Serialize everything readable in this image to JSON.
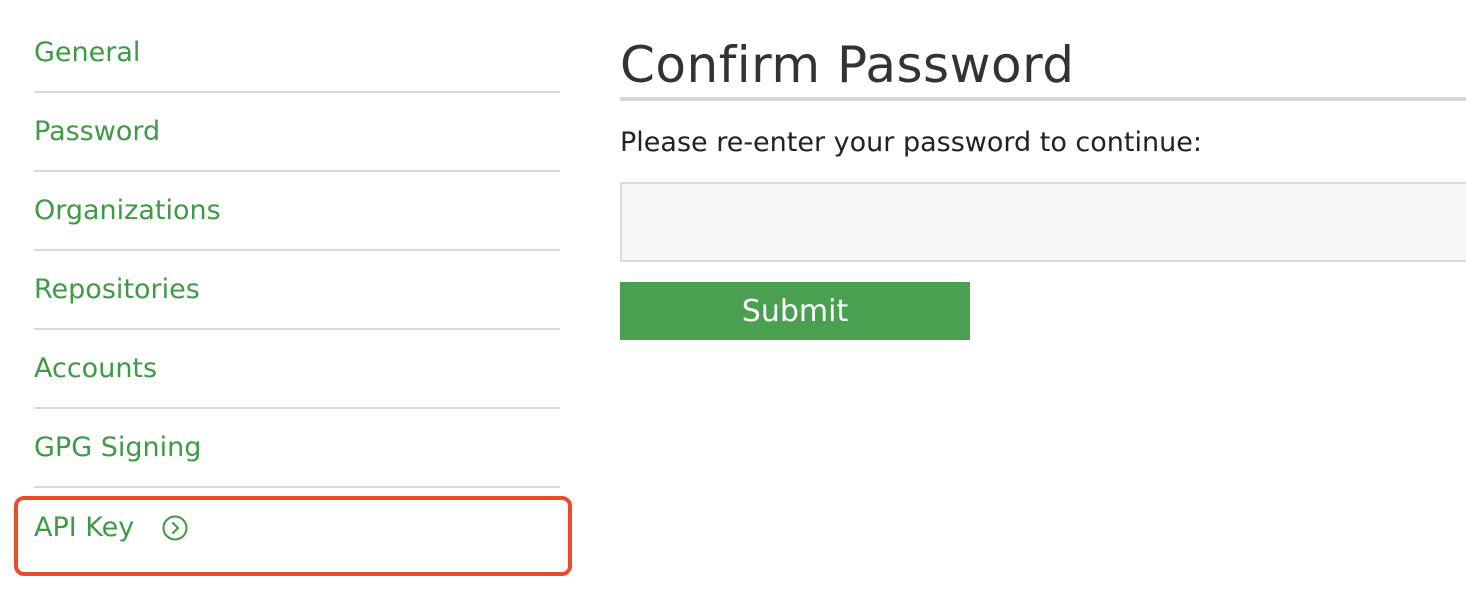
{
  "sidebar": {
    "items": [
      {
        "label": "General"
      },
      {
        "label": "Password"
      },
      {
        "label": "Organizations"
      },
      {
        "label": "Repositories"
      },
      {
        "label": "Accounts"
      },
      {
        "label": "GPG Signing"
      },
      {
        "label": "API Key",
        "icon": "chevron-right-circle-icon",
        "highlighted": true
      }
    ]
  },
  "main": {
    "title": "Confirm Password",
    "instructions": "Please re-enter your password to continue:",
    "password_input": {
      "value": "",
      "placeholder": ""
    },
    "submit_label": "Submit"
  },
  "colors": {
    "link_green": "#3e9a44",
    "button_green": "#4aa050",
    "highlight_red": "#ea4b2a",
    "divider": "#d9d9d9"
  }
}
